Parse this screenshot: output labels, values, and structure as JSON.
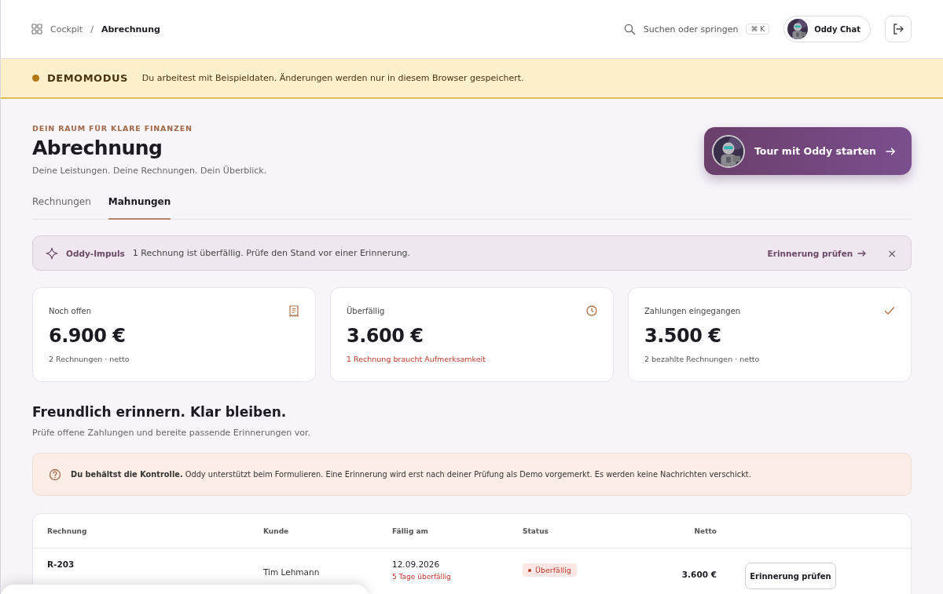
{
  "breadcrumb": [
    {
      "label": "Cockpit",
      "current": false
    },
    {
      "label": "Abrechnung",
      "current": true
    }
  ],
  "breadcrumb_separator": "/",
  "search": {
    "placeholder": "Suchen oder springen",
    "shortcut": "⌘ K"
  },
  "chat_button": {
    "label": "Oddy Chat"
  },
  "demo_banner": {
    "title": "DEMOMODUS",
    "text": "Du arbeitest mit Beispieldaten. Änderungen werden nur in diesem Browser gespeichert."
  },
  "page": {
    "eyebrow": "DEIN RAUM FÜR KLARE FINANZEN",
    "title": "Abrechnung",
    "subtitle": "Deine Leistungen. Deine Rechnungen. Dein Überblick.",
    "tour_button": "Tour mit Oddy starten"
  },
  "tabs": [
    {
      "label": "Rechnungen",
      "selected": false
    },
    {
      "label": "Mahnungen",
      "selected": true
    }
  ],
  "impulse": {
    "label": "Oddy-Impuls",
    "text": "1 Rechnung ist überfällig. Prüfe den Stand vor einer Erinnerung.",
    "action": "Erinnerung prüfen",
    "close": "×"
  },
  "stats": [
    {
      "label": "Noch offen",
      "value": "6.900 €",
      "note": "2 Rechnungen · netto",
      "kind": "receipt",
      "alert": false
    },
    {
      "label": "Überfällig",
      "value": "3.600 €",
      "note": "1 Rechnung braucht Aufmerksamkeit",
      "kind": "clock",
      "alert": true
    },
    {
      "label": "Zahlungen eingegangen",
      "value": "3.500 €",
      "note": "2 bezahlte Rechnungen · netto",
      "kind": "check",
      "alert": false
    }
  ],
  "section": {
    "title": "Freundlich erinnern. Klar bleiben.",
    "subtitle": "Prüfe offene Zahlungen und bereite passende Erinnerungen vor."
  },
  "notice": {
    "text": "**Du behältst die Kontrolle.** Oddy unterstützt beim Formulieren. Eine Erinnerung wird erst nach deiner Prüfung als Demo vorgemerkt. Es werden keine Nachrichten verschickt."
  },
  "table": {
    "columns": [
      "Rechnung",
      "Kunde",
      "Fällig am",
      "Status",
      "Netto"
    ],
    "rows": [
      {
        "invoice": "R-203",
        "customer": "Tim Lehmann",
        "due": "12.09.2026",
        "due_note": "5 Tage überfällig",
        "status": "Überfällig",
        "kind": "overdue",
        "net": "3.600 €",
        "action": "Erinnerung prüfen"
      }
    ]
  }
}
